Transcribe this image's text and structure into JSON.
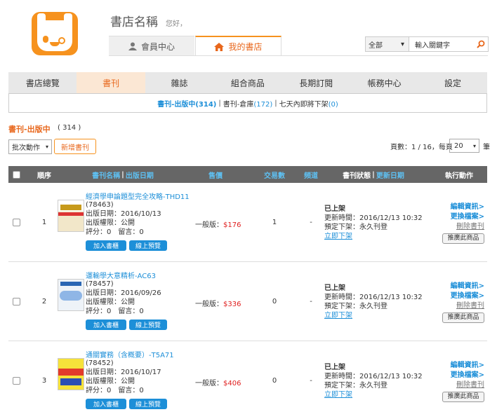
{
  "header": {
    "store_name": "書店名稱",
    "greeting": "您好，",
    "tabs": {
      "member": "會員中心",
      "mystore": "我的書店"
    },
    "search": {
      "category": "全部",
      "placeholder": "輸入關鍵字"
    }
  },
  "nav": [
    "書店總覽",
    "書刊",
    "雜誌",
    "組合商品",
    "長期訂閱",
    "帳務中心",
    "設定"
  ],
  "subnav": {
    "selected_label": "書刊-出版中(314)",
    "storage_label": "書刊-倉庫",
    "storage_count": "(172)",
    "expiring_label": "七天內即將下架",
    "expiring_count": "(0)",
    "sep": "|"
  },
  "section": {
    "title": "書刊-出版中",
    "count": "( 314 )"
  },
  "toolbar": {
    "batch_label": "批次動作",
    "add_label": "新增書刊",
    "pager_text": "頁數：1 / 16，每頁",
    "per_page": "20",
    "unit": "筆"
  },
  "table": {
    "headers": {
      "order": "順序",
      "name": "書刊名稱",
      "pubdate": "出版日期",
      "name_sep": "|",
      "price": "售價",
      "tx": "交易數",
      "channel": "頻道",
      "status": "書刊狀態",
      "updated": "更新日期",
      "status_sep": "|",
      "actions": "執行動作"
    },
    "rows": [
      {
        "idx": "1",
        "title": "經濟學申論題型完全攻略-THD11",
        "code": "(78463)",
        "pub": "出版日期：2016/10/13",
        "perm": "出版權限：公開",
        "rating": "評分：0　留言：0",
        "price_label": "一般版：",
        "price": "$176",
        "tx": "1",
        "channel": "-",
        "status": "已上架",
        "updated": "更新時間：2016/12/13 10:32",
        "offline": "預定下架：永久刊登",
        "offline_now": "立即下架"
      },
      {
        "idx": "2",
        "title": "運輸學大意精析-AC63",
        "code": "(78457)",
        "pub": "出版日期：2016/09/26",
        "perm": "出版權限：公開",
        "rating": "評分：0　留言：0",
        "price_label": "一般版：",
        "price": "$336",
        "tx": "0",
        "channel": "-",
        "status": "已上架",
        "updated": "更新時間：2016/12/13 10:32",
        "offline": "預定下架：永久刊登",
        "offline_now": "立即下架"
      },
      {
        "idx": "3",
        "title": "通關實務（含概要）-T5A71",
        "code": "(78452)",
        "pub": "出版日期：2016/10/17",
        "perm": "出版權限：公開",
        "rating": "評分：0　留言：0",
        "price_label": "一般版：",
        "price": "$406",
        "tx": "0",
        "channel": "-",
        "status": "已上架",
        "updated": "更新時間：2016/12/13 10:32",
        "offline": "預定下架：永久刊登",
        "offline_now": "立即下架"
      }
    ],
    "row_buttons": {
      "cart": "加入書櫃",
      "preview": "線上預覽"
    },
    "row_actions": {
      "edit": "編輯資訊>",
      "replace": "更換檔案>",
      "delete": "刪除書刊",
      "promote": "推廣此商品"
    }
  },
  "colors": {
    "accent": "#f6921e",
    "link": "#1d8fd8",
    "price": "#e02020"
  }
}
